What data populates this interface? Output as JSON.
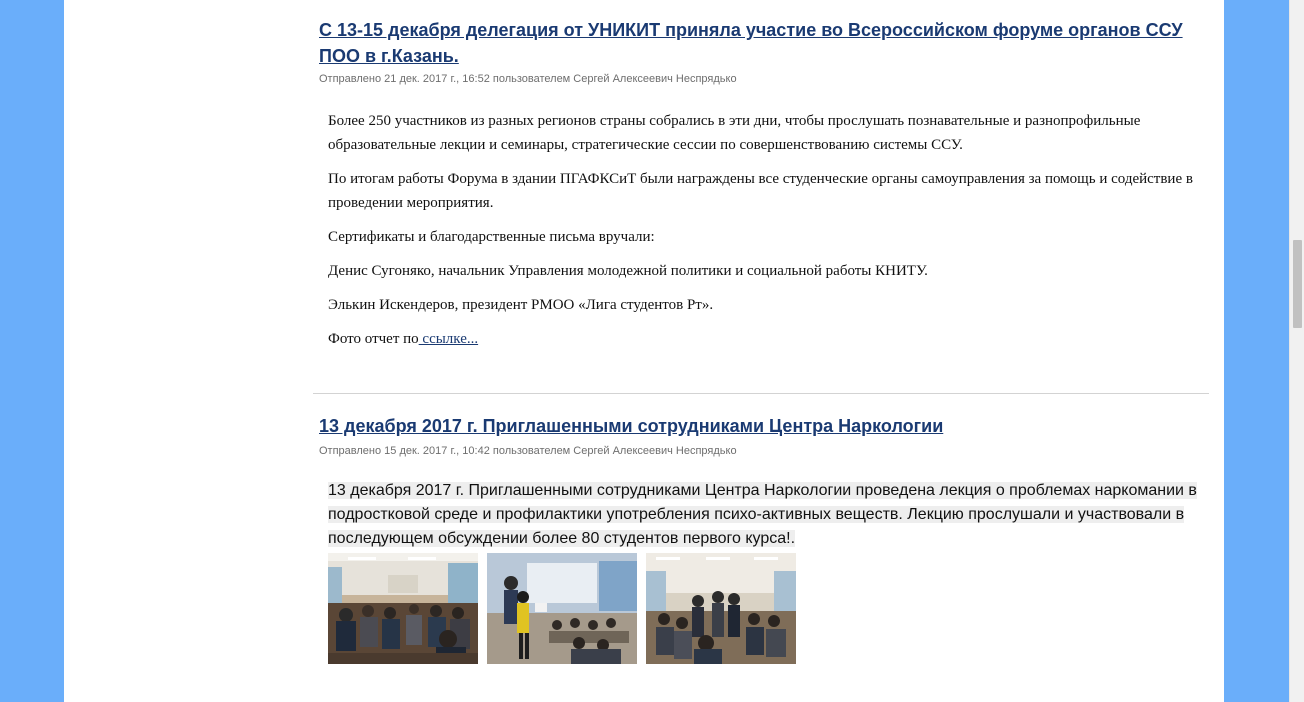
{
  "articles": [
    {
      "title": "С 13-15 декабря делегация от УНИКИТ приняла участие во Всероссийском форуме органов ССУ ПОО в г.Казань.",
      "meta": "Отправлено 21 дек. 2017 г., 16:52 пользователем Сергей Алексеевич Неспрядько",
      "paragraphs": [
        "Более 250 участников из разных регионов страны собрались в эти дни, чтобы прослушать познавательные и разнопрофильные образовательные лекции и семинары, стратегические сессии по совершенствованию системы ССУ.",
        "По итогам работы Форума в здании ПГАФКСиТ были награждены все студенческие органы самоуправления за помощь и содействие в проведении мероприятия.",
        "Сертификаты и благодарственные письма вручали:",
        "Денис Сугоняко, начальник Управления молодежной политики и социальной работы КНИТУ.",
        "Элькин Искендеров, президент РМОО «Лига студентов Рт»."
      ],
      "photo_report_text": "Фото отчет по",
      "photo_report_link": " ссылке..."
    },
    {
      "title": "13 декабря 2017 г. Приглашенными сотрудниками Центра Наркологии",
      "meta": "Отправлено 15 дек. 2017 г., 10:42 пользователем Сергей Алексеевич Неспрядько",
      "lead": "13 декабря 2017 г. Приглашенными сотрудниками Центра Наркологии проведена лекция о проблемах наркомании в подростковой среде и профилактики употребления психо-активных веществ. Лекцию прослушали и участвовали в последующем обсуждении более 80 студентов первого курса!.",
      "photos": [
        "lecture-photo-1",
        "lecture-photo-2",
        "lecture-photo-3"
      ]
    }
  ],
  "colors": {
    "background": "#6aaefa",
    "page": "#ffffff",
    "title_link": "#1a3a72",
    "meta_text": "#6e6e6e"
  }
}
